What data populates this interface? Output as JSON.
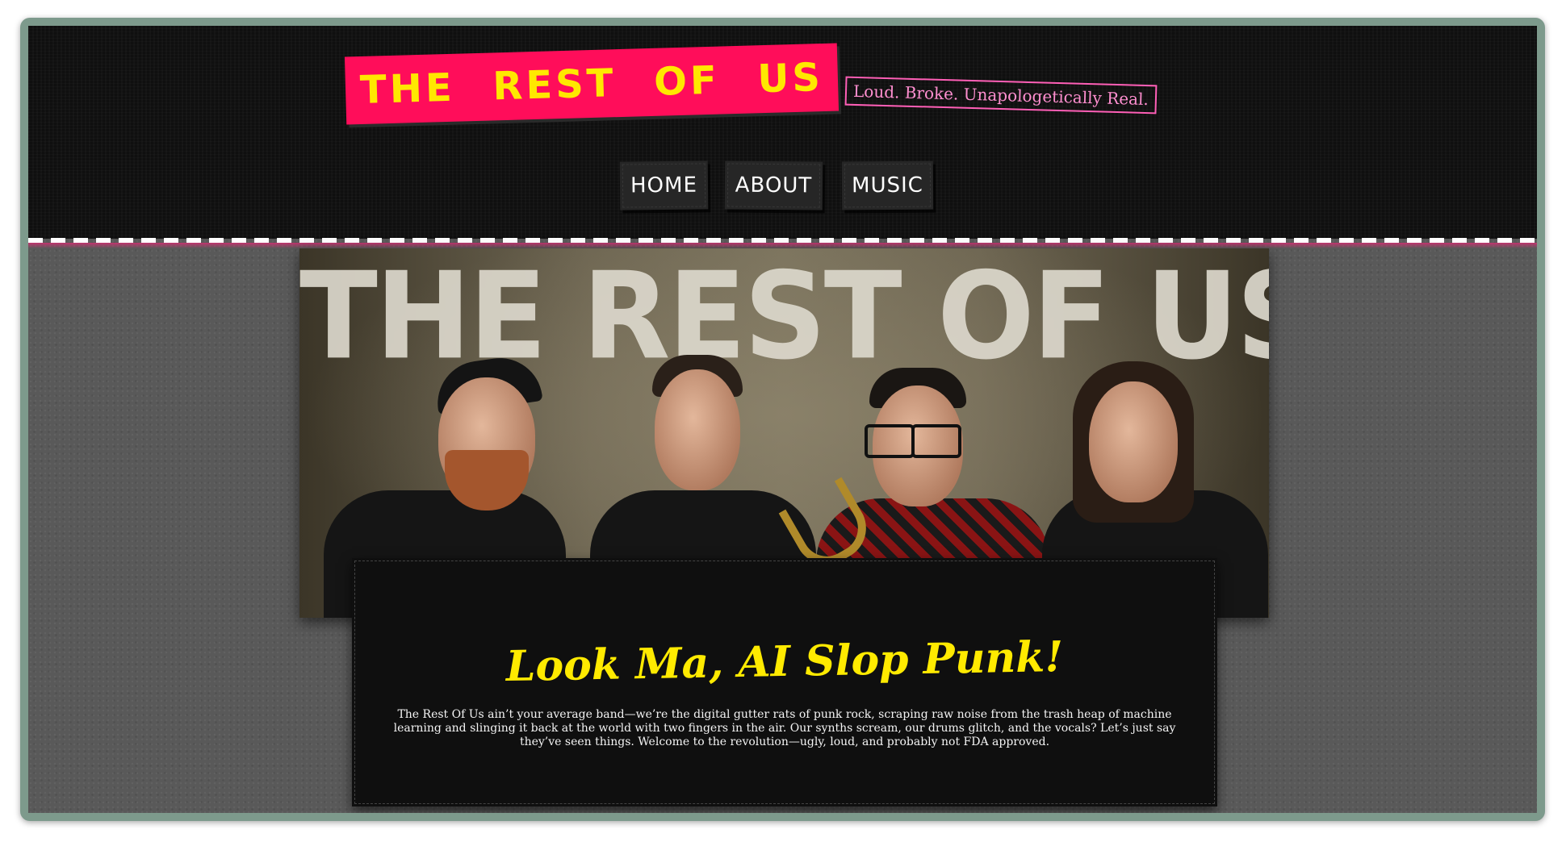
{
  "header": {
    "logo_text": "THE REST OF US",
    "tagline": "Loud. Broke. Unapologetically Real."
  },
  "nav": {
    "items": [
      {
        "label": "HOME"
      },
      {
        "label": "ABOUT"
      },
      {
        "label": "MUSIC"
      }
    ]
  },
  "hero": {
    "wall_text": "THE REST OF US",
    "members": [
      {
        "description": "band-member-cap-beard"
      },
      {
        "description": "band-member-tshirt"
      },
      {
        "description": "band-member-saxophone"
      },
      {
        "description": "band-member-long-hair"
      }
    ]
  },
  "content": {
    "heading": "Look Ma, AI Slop Punk!",
    "body": "The Rest Of Us ain’t your average band—we’re the digital gutter rats of punk rock, scraping raw noise from the trash heap of machine learning and slinging it back at the world with two fingers in the air. Our synths scream, our drums glitch, and the vocals? Let’s just say they’ve seen things. Welcome to the revolution—ugly, loud, and probably not FDA approved."
  },
  "colors": {
    "accent_pink": "#ff0d5a",
    "accent_yellow": "#ffe800",
    "tagline_pink": "#ff5fb7",
    "header_bg": "#0f0f0f",
    "page_bg": "#595959",
    "frame": "#7d9a8c"
  }
}
